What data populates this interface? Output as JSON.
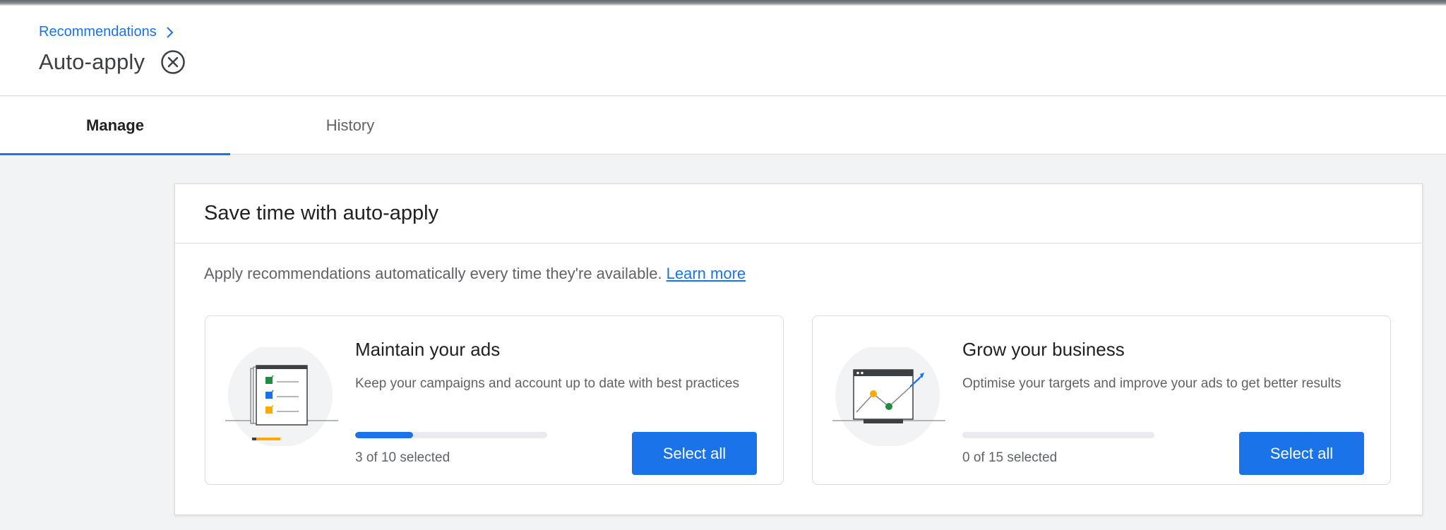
{
  "breadcrumb": {
    "parent_label": "Recommendations"
  },
  "page": {
    "title": "Auto-apply"
  },
  "tabs": [
    {
      "label": "Manage",
      "active": true
    },
    {
      "label": "History",
      "active": false
    }
  ],
  "card": {
    "title": "Save time with auto-apply",
    "description": "Apply recommendations automatically every time they're available.",
    "learn_more_label": "Learn more"
  },
  "options": [
    {
      "title": "Maintain your ads",
      "description": "Keep your campaigns and account up to date with best practices",
      "selected": 3,
      "total": 10,
      "selected_label": "3 of 10 selected",
      "button_label": "Select all"
    },
    {
      "title": "Grow your business",
      "description": "Optimise your targets and improve your ads to get better results",
      "selected": 0,
      "total": 15,
      "selected_label": "0 of 15 selected",
      "button_label": "Select all"
    }
  ],
  "colors": {
    "accent": "#1a73e8",
    "check_green": "#1e8e3e",
    "check_yellow": "#f9ab00"
  },
  "icons": [
    "chevron-right-icon",
    "close-circle-icon",
    "checklist-illustration",
    "growth-chart-illustration"
  ]
}
